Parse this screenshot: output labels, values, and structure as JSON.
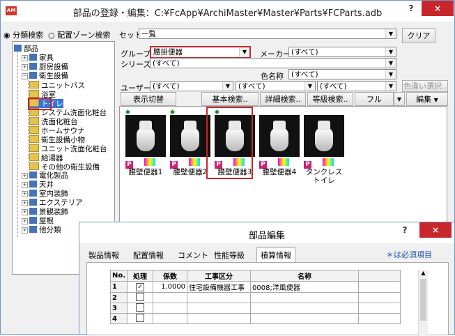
{
  "window": {
    "title": "部品の登録・編集：C:¥FcApp¥ArchiMaster¥Master¥Parts¥FCParts.adb",
    "app_icon": "AM",
    "help_glyph": "?",
    "close_glyph": "×"
  },
  "search": {
    "radio_category": "分類検索",
    "radio_zone": "配置ゾーン検索",
    "set_label": "セット",
    "set_value": "一覧",
    "clear_button": "クリア"
  },
  "filters": {
    "group_label": "グループ",
    "group_value": "腰掛便器",
    "maker_label": "メーカー",
    "maker_value": "(すべて)",
    "series_label": "シリーズ",
    "series_value": "(すべて)",
    "color_label": "色名称",
    "color_value": "(すべて)",
    "user_label": "ユーザー",
    "user_value1": "(すべて)",
    "user_value2": "(すべて)",
    "user_value3": "(すべて)",
    "color_variant_button": "色違い選択.."
  },
  "toolbar": {
    "display_toggle": "表示切替",
    "basic_search": "基本検索..",
    "detail_search": "詳細検索..",
    "grade_search": "等級検索..",
    "full": "フル",
    "edit": "編集"
  },
  "tree": {
    "items": [
      {
        "label": "部品",
        "kind": "book",
        "pm": ""
      },
      {
        "label": "家具",
        "kind": "book",
        "pm": "+"
      },
      {
        "label": "厨房設備",
        "kind": "book",
        "pm": "+"
      },
      {
        "label": "衛生設備",
        "kind": "book",
        "pm": "−"
      },
      {
        "label": "ユニットバス",
        "kind": "folder",
        "pm": ""
      },
      {
        "label": "浴室",
        "kind": "folder",
        "pm": ""
      },
      {
        "label": "トイレ",
        "kind": "folder",
        "pm": ""
      },
      {
        "label": "システム洗面化粧台",
        "kind": "folder",
        "pm": ""
      },
      {
        "label": "洗面化粧台",
        "kind": "folder",
        "pm": ""
      },
      {
        "label": "ホームサウナ",
        "kind": "folder",
        "pm": ""
      },
      {
        "label": "衛生設備小物",
        "kind": "folder",
        "pm": ""
      },
      {
        "label": "ユニット洗面化粧台",
        "kind": "folder",
        "pm": ""
      },
      {
        "label": "給湯器",
        "kind": "folder",
        "pm": ""
      },
      {
        "label": "その他の衛生設備",
        "kind": "folder",
        "pm": ""
      },
      {
        "label": "電化製品",
        "kind": "book",
        "pm": "+"
      },
      {
        "label": "天井",
        "kind": "book",
        "pm": "+"
      },
      {
        "label": "室内装飾",
        "kind": "book",
        "pm": "+"
      },
      {
        "label": "エクステリア",
        "kind": "book",
        "pm": "+"
      },
      {
        "label": "景観装飾",
        "kind": "book",
        "pm": "+"
      },
      {
        "label": "屋根",
        "kind": "book",
        "pm": "+"
      },
      {
        "label": "他分類",
        "kind": "book",
        "pm": "+"
      }
    ]
  },
  "parts": [
    {
      "name": "腰壁便器1",
      "badge": "P"
    },
    {
      "name": "腰壁便器2",
      "badge": "P"
    },
    {
      "name": "腰壁便器3",
      "badge": "P"
    },
    {
      "name": "腰壁便器4",
      "badge": "P"
    },
    {
      "name": "タンクレストイレ",
      "badge": "P"
    }
  ],
  "dialog": {
    "title": "部品編集",
    "required_note": "＊は必須項目",
    "tabs": [
      "製品情報",
      "配置情報",
      "コメント",
      "性能等級",
      "積算情報"
    ],
    "columns": [
      "No.",
      "処理",
      "係数",
      "工事区分",
      "名称"
    ],
    "rows": [
      {
        "no": "1",
        "checked": "✓",
        "factor": "1.0000",
        "category": "住宅設備機器工事",
        "name": "0008;洋風便器"
      },
      {
        "no": "2",
        "checked": "",
        "factor": "",
        "category": "",
        "name": ""
      },
      {
        "no": "3",
        "checked": "",
        "factor": "",
        "category": "",
        "name": ""
      },
      {
        "no": "4",
        "checked": "",
        "factor": "",
        "category": "",
        "name": ""
      }
    ]
  },
  "colors": {
    "highlight": "#c8262a",
    "accent": "#1e4fb3",
    "close": "#c8262a"
  }
}
